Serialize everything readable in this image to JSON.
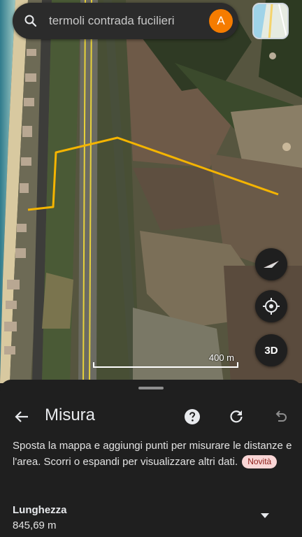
{
  "search": {
    "query": "termoli contrada fucilieri",
    "avatar_letter": "A"
  },
  "map": {
    "scale_label": "400 m",
    "buttons": {
      "three_d": "3D"
    },
    "colors": {
      "measure_line": "#f4b400",
      "road_yellow": "#e8d23a"
    }
  },
  "panel": {
    "title": "Misura",
    "description": "Sposta la mappa e aggiungi punti per misurare le distanze e l'area. Scorri o espandi per visualizzare altri dati.",
    "badge": "Novità",
    "length_label": "Lunghezza",
    "length_value": "845,69 m",
    "icons": [
      "back-arrow-icon",
      "help-icon",
      "refresh-icon",
      "undo-icon",
      "chevron-down-icon"
    ]
  }
}
